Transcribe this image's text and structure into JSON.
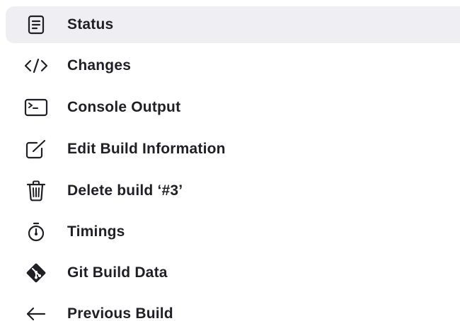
{
  "menu": {
    "items": [
      {
        "label": "Status",
        "icon": "document-icon",
        "active": true
      },
      {
        "label": "Changes",
        "icon": "code-icon",
        "active": false
      },
      {
        "label": "Console Output",
        "icon": "terminal-icon",
        "active": false
      },
      {
        "label": "Edit Build Information",
        "icon": "edit-icon",
        "active": false
      },
      {
        "label": "Delete build ‘#3’",
        "icon": "trash-icon",
        "active": false
      },
      {
        "label": "Timings",
        "icon": "stopwatch-icon",
        "active": false
      },
      {
        "label": "Git Build Data",
        "icon": "git-icon",
        "active": false
      },
      {
        "label": "Previous Build",
        "icon": "arrow-left-icon",
        "active": false
      }
    ]
  },
  "colors": {
    "active_background": "#eeeef3",
    "text": "#1f1f24"
  }
}
